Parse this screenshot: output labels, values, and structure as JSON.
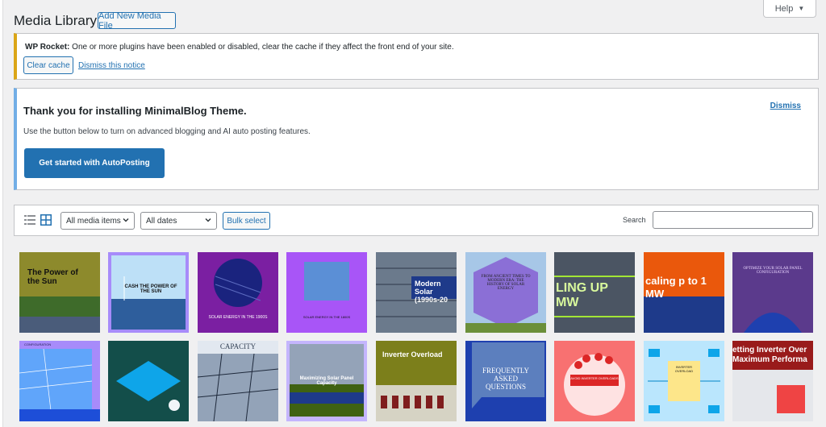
{
  "header": {
    "title": "Media Library",
    "add_new_label": "Add New Media File",
    "help_label": "Help"
  },
  "notice_rocket": {
    "brand": "WP Rocket:",
    "message": " One or more plugins have been enabled or disabled, clear the cache if they affect the front end of your site.",
    "clear_cache_label": "Clear cache",
    "dismiss_label": "Dismiss this notice"
  },
  "notice_theme": {
    "heading": "Thank you for installing MinimalBlog Theme.",
    "subtext": "Use the button below to turn on advanced blogging and AI auto posting features.",
    "dismiss_label": "Dismiss",
    "cta_label": "Get started with AutoPosting"
  },
  "toolbar": {
    "list_view_icon": "list-view-icon",
    "grid_view_icon": "grid-view-icon",
    "media_filter": "All media items",
    "date_filter": "All dates",
    "bulk_select_label": "Bulk select",
    "search_label": "Search",
    "search_value": ""
  },
  "colors": {
    "link_blue": "#2271b1",
    "warning": "#dba617",
    "info": "#72aee6",
    "background": "#f0f0f1"
  },
  "media": {
    "row1": [
      {
        "text": "The Power of the Sun"
      },
      {
        "text": "CASH THE POWER OF THE SUN"
      },
      {
        "text": "SOLAR ENERGY IN THE 1900S"
      },
      {
        "text": "SOLAR ENERGY IN THE 1800S"
      },
      {
        "text": "Modern Solar (1990s-20"
      },
      {
        "text": "FROM ANCIENT TIMES TO MODERN ERA: THE HISTORY OF SOLAR ENERGY"
      },
      {
        "text": "LING UP MW"
      },
      {
        "text": "caling p to 1 MW"
      },
      {
        "text": "OPTIMIZE YOUR SOLAR PANEL CONFIGURATION"
      }
    ],
    "row2": [
      {
        "text": "CONFIGURATION"
      },
      {
        "text": ""
      },
      {
        "text": "CAPACITY"
      },
      {
        "text": "Maximizing Solar Panel Capacity"
      },
      {
        "text": "Inverter Overload"
      },
      {
        "text": "FREQUENTLY ASKED QUESTIONS"
      },
      {
        "text": "AVOID INVERTER OVERLOADS"
      },
      {
        "text": "INVERTER OVERLOAD"
      },
      {
        "text": "etting Inverter Over Maximum Performa"
      }
    ]
  }
}
